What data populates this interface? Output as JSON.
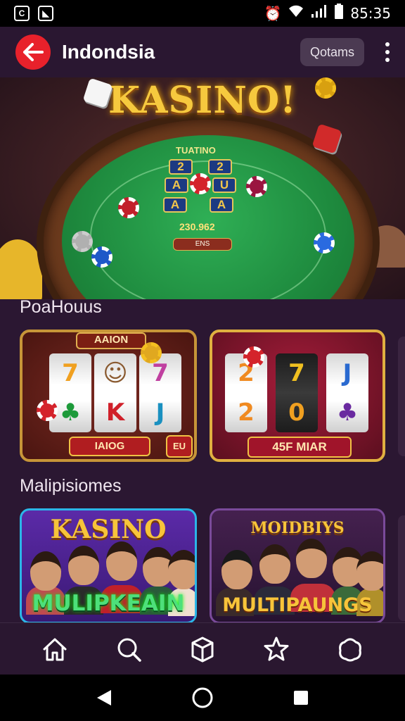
{
  "status_bar": {
    "time": "85:35"
  },
  "app_bar": {
    "title": "Indondsia",
    "pill_button": "Qotams"
  },
  "hero": {
    "title": "KASINO!",
    "felt_label": "TUATINO",
    "cards": [
      "2",
      "2",
      "A",
      "U",
      "A",
      "A"
    ],
    "amount": "230.962",
    "button": "ENS"
  },
  "sections": [
    {
      "label": "PoaHouus"
    },
    {
      "label": "Malipisiomes"
    }
  ],
  "slot_tiles": [
    {
      "top_label": "AAION",
      "bottom_label": "IAIOG",
      "badge": "EU",
      "reels": [
        [
          "7",
          "♣"
        ],
        [
          "☺",
          "K"
        ],
        [
          "7",
          "J"
        ]
      ]
    },
    {
      "bottom_label": "45F MIAR",
      "reels": [
        [
          "2",
          "2"
        ],
        [
          "7",
          "0"
        ],
        [
          "J",
          "♣"
        ]
      ]
    }
  ],
  "multi_tiles": [
    {
      "title": "KASINO",
      "bottom": "MULIPKEAIN"
    },
    {
      "title": "MOIDBIYS",
      "bottom": "MULTIPAUNGS"
    }
  ],
  "bottom_nav": [
    "home-icon",
    "search-icon",
    "box-icon",
    "star-icon",
    "profile-icon"
  ],
  "accent": "#e8212b"
}
